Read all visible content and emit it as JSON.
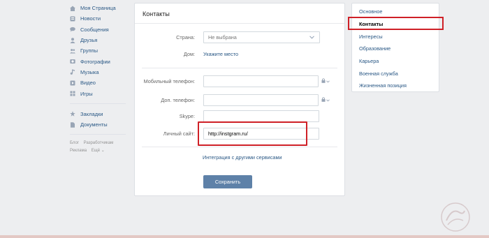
{
  "nav": {
    "items": [
      {
        "label": "Моя Страница",
        "icon": "home-icon"
      },
      {
        "label": "Новости",
        "icon": "news-icon"
      },
      {
        "label": "Сообщения",
        "icon": "messages-icon"
      },
      {
        "label": "Друзья",
        "icon": "friends-icon"
      },
      {
        "label": "Группы",
        "icon": "groups-icon"
      },
      {
        "label": "Фотографии",
        "icon": "photos-icon"
      },
      {
        "label": "Музыка",
        "icon": "music-icon"
      },
      {
        "label": "Видео",
        "icon": "video-icon"
      },
      {
        "label": "Игры",
        "icon": "games-icon"
      }
    ],
    "items2": [
      {
        "label": "Закладки",
        "icon": "star-icon"
      },
      {
        "label": "Документы",
        "icon": "documents-icon"
      }
    ],
    "footer": {
      "blog": "Блог",
      "developers": "Разработчикам",
      "ads": "Реклама",
      "more": "Ещё ⌄"
    }
  },
  "card": {
    "title": "Контакты",
    "country_label": "Страна:",
    "country_value": "Не выбрана",
    "home_label": "Дом:",
    "home_link": "Укажите место",
    "mobile_label": "Мобильный телефон:",
    "mobile_value": "",
    "phone_label": "Доп. телефон:",
    "phone_value": "",
    "skype_label": "Skype:",
    "skype_value": "",
    "site_label": "Личный сайт:",
    "site_value": "http://instgram.ru/",
    "integration_link": "Интеграция с другими сервисами",
    "save_label": "Сохранить"
  },
  "menu": {
    "items": [
      {
        "label": "Основное",
        "active": false
      },
      {
        "label": "Контакты",
        "active": true
      },
      {
        "label": "Интересы",
        "active": false
      },
      {
        "label": "Образование",
        "active": false
      },
      {
        "label": "Карьера",
        "active": false
      },
      {
        "label": "Военная служба",
        "active": false
      },
      {
        "label": "Жизненная позиция",
        "active": false
      }
    ]
  },
  "colors": {
    "link": "#2a5885",
    "button": "#5e81a8",
    "highlight": "#cf2027",
    "background": "#edeef0"
  }
}
